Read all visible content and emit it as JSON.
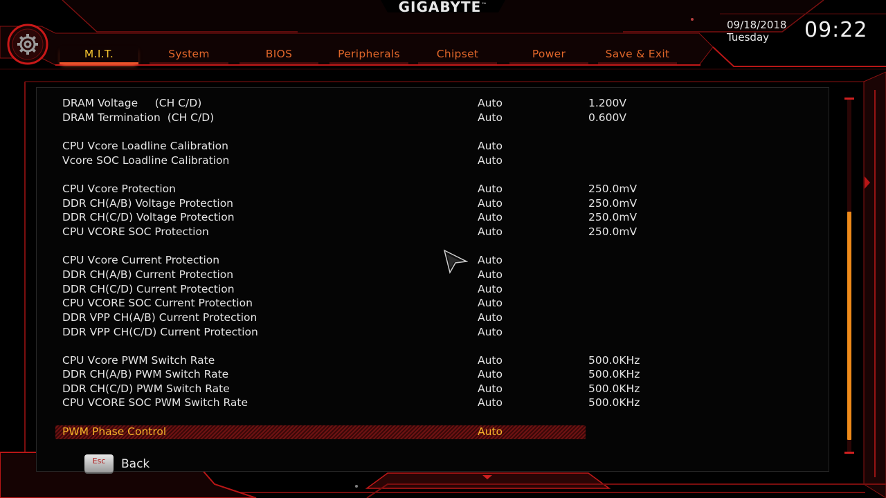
{
  "header": {
    "brand": "GIGABYTE",
    "brand_mark": "™",
    "date": "09/18/2018",
    "weekday": "Tuesday",
    "time": "09:22"
  },
  "tabs": [
    {
      "label": "M.I.T.",
      "active": true
    },
    {
      "label": "System",
      "active": false
    },
    {
      "label": "BIOS",
      "active": false
    },
    {
      "label": "Peripherals",
      "active": false
    },
    {
      "label": "Chipset",
      "active": false
    },
    {
      "label": "Power",
      "active": false
    },
    {
      "label": "Save & Exit",
      "active": false
    }
  ],
  "settings": [
    {
      "label": "DRAM Voltage     (CH C/D)",
      "value": "Auto",
      "reading": "1.200V"
    },
    {
      "label": "DRAM Termination  (CH C/D)",
      "value": "Auto",
      "reading": "0.600V"
    },
    {
      "label": "CPU Vcore Loadline Calibration",
      "value": "Auto",
      "reading": ""
    },
    {
      "label": "Vcore SOC Loadline Calibration",
      "value": "Auto",
      "reading": ""
    },
    {
      "label": "CPU Vcore Protection",
      "value": "Auto",
      "reading": "250.0mV"
    },
    {
      "label": "DDR CH(A/B) Voltage Protection",
      "value": "Auto",
      "reading": "250.0mV"
    },
    {
      "label": "DDR CH(C/D) Voltage Protection",
      "value": "Auto",
      "reading": "250.0mV"
    },
    {
      "label": "CPU VCORE SOC Protection",
      "value": "Auto",
      "reading": "250.0mV"
    },
    {
      "label": "CPU Vcore Current Protection",
      "value": "Auto",
      "reading": ""
    },
    {
      "label": "DDR CH(A/B) Current Protection",
      "value": "Auto",
      "reading": ""
    },
    {
      "label": "DDR CH(C/D) Current Protection",
      "value": "Auto",
      "reading": ""
    },
    {
      "label": "CPU VCORE SOC Current Protection",
      "value": "Auto",
      "reading": ""
    },
    {
      "label": "DDR VPP CH(A/B) Current Protection",
      "value": "Auto",
      "reading": ""
    },
    {
      "label": "DDR VPP CH(C/D) Current Protection",
      "value": "Auto",
      "reading": ""
    },
    {
      "label": "CPU Vcore PWM Switch Rate",
      "value": "Auto",
      "reading": "500.0KHz"
    },
    {
      "label": "DDR CH(A/B) PWM Switch Rate",
      "value": "Auto",
      "reading": "500.0KHz"
    },
    {
      "label": "DDR CH(C/D) PWM Switch Rate",
      "value": "Auto",
      "reading": "500.0KHz"
    },
    {
      "label": "CPU VCORE SOC PWM Switch Rate",
      "value": "Auto",
      "reading": "500.0KHz"
    },
    {
      "label": "PWM Phase Control",
      "value": "Auto",
      "reading": "",
      "selected": true
    }
  ],
  "footer": {
    "esc_key": "Esc",
    "back_label": "Back"
  },
  "icons": [
    "gear-icon",
    "esc-key-icon",
    "mouse-cursor-icon",
    "right-arrow-icon",
    "down-arrow-icon"
  ],
  "colors": {
    "accent_red": "#c81818",
    "tab_text": "#e0662a",
    "tab_active_text": "#f2c230",
    "selected_text": "#f5b42a",
    "scroll_thumb": "#ee8a1a"
  }
}
